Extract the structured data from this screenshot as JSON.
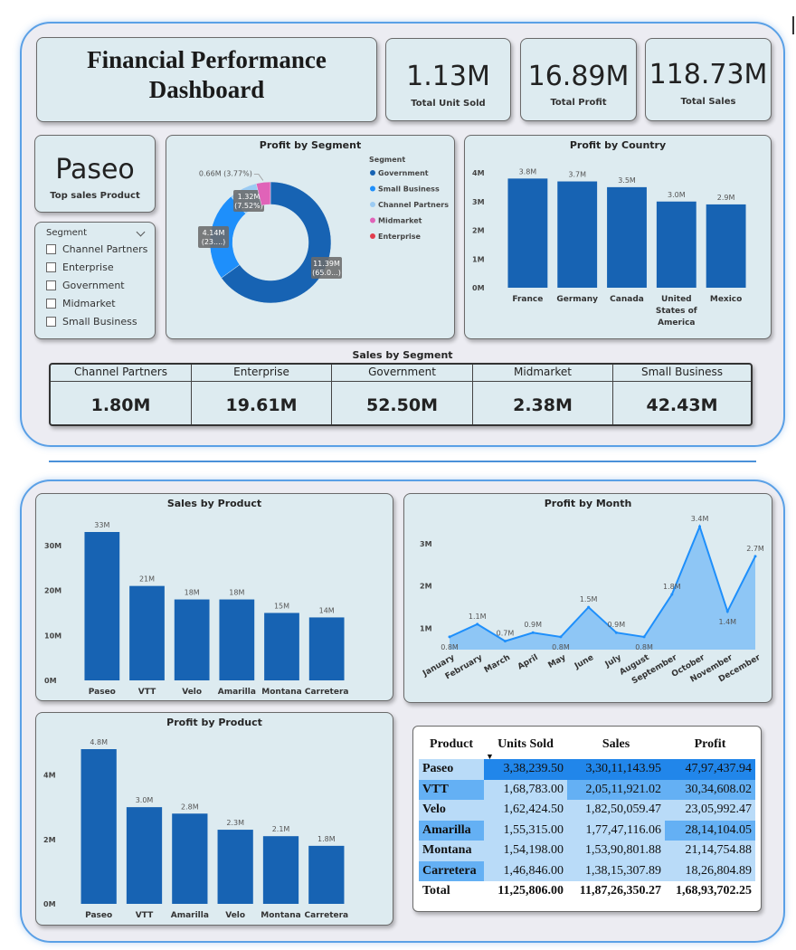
{
  "title": "Financial Performance Dashboard",
  "kpis": [
    {
      "value": "1.13M",
      "label": "Total Unit Sold"
    },
    {
      "value": "16.89M",
      "label": "Total Profit"
    },
    {
      "value": "118.73M",
      "label": "Total Sales"
    }
  ],
  "top_product": {
    "value": "Paseo",
    "label": "Top sales Product"
  },
  "slicer": {
    "title": "Segment",
    "items": [
      "Channel Partners",
      "Enterprise",
      "Government",
      "Midmarket",
      "Small Business"
    ]
  },
  "sales_by_segment": {
    "title": "Sales by Segment",
    "items": [
      {
        "name": "Channel Partners",
        "value": "1.80M"
      },
      {
        "name": "Enterprise",
        "value": "19.61M"
      },
      {
        "name": "Government",
        "value": "52.50M"
      },
      {
        "name": "Midmarket",
        "value": "2.38M"
      },
      {
        "name": "Small Business",
        "value": "42.43M"
      }
    ]
  },
  "colors": {
    "bar": "#1763b3",
    "government": "#1763b3",
    "small_business": "#1e8ffb",
    "channel_partners": "#9bcbf3",
    "midmarket": "#e063b8",
    "enterprise": "#e23d4d",
    "area_fill": "#8ec6f5",
    "area_line": "#1e8ffb",
    "table_highlight": "#2186ea",
    "table_mid": "#64b0f4",
    "table_light": "#b9dbf8"
  },
  "chart_data": [
    {
      "id": "profit_by_segment",
      "type": "pie",
      "title": "Profit by Segment",
      "legend_title": "Segment",
      "legend_position": "right",
      "legend": [
        "Government",
        "Small Business",
        "Channel Partners",
        "Midmarket",
        "Enterprise"
      ],
      "slices": [
        {
          "name": "Government",
          "value": 11.39,
          "label_line1": "11.39M",
          "label_line2": "(65.0...)"
        },
        {
          "name": "Small Business",
          "value": 4.14,
          "label_line1": "4.14M",
          "label_line2": "(23....)"
        },
        {
          "name": "Channel Partners",
          "value": 1.32,
          "label_line1": "1.32M",
          "label_line2": "(7.52%)"
        },
        {
          "name": "Midmarket",
          "value": 0.66,
          "label_line1": "0.66M (3.77%)",
          "label_line2": ""
        },
        {
          "name": "Enterprise",
          "value": 0.0,
          "label_line1": "",
          "label_line2": ""
        }
      ]
    },
    {
      "id": "profit_by_country",
      "type": "bar",
      "title": "Profit by Country",
      "categories": [
        [
          "France"
        ],
        [
          "Germany"
        ],
        [
          "Canada"
        ],
        [
          "United",
          "States of",
          "America"
        ],
        [
          "Mexico"
        ]
      ],
      "values": [
        3.8,
        3.7,
        3.5,
        3.0,
        2.9
      ],
      "data_labels": [
        "3.8M",
        "3.7M",
        "3.5M",
        "3.0M",
        "2.9M"
      ],
      "ylim": [
        0,
        4
      ],
      "yticks": [
        {
          "v": 0,
          "label": "0M"
        },
        {
          "v": 1,
          "label": "1M"
        },
        {
          "v": 2,
          "label": "2M"
        },
        {
          "v": 3,
          "label": "3M"
        },
        {
          "v": 4,
          "label": "4M"
        }
      ]
    },
    {
      "id": "sales_by_product",
      "type": "bar",
      "title": "Sales by Product",
      "categories": [
        [
          "Paseo"
        ],
        [
          "VTT"
        ],
        [
          "Velo"
        ],
        [
          "Amarilla"
        ],
        [
          "Montana"
        ],
        [
          "Carretera"
        ]
      ],
      "values": [
        33,
        21,
        18,
        18,
        15,
        14
      ],
      "data_labels": [
        "33M",
        "21M",
        "18M",
        "18M",
        "15M",
        "14M"
      ],
      "ylim": [
        0,
        33
      ],
      "yticks": [
        {
          "v": 0,
          "label": "0M"
        },
        {
          "v": 10,
          "label": "10M"
        },
        {
          "v": 20,
          "label": "20M"
        },
        {
          "v": 30,
          "label": "30M"
        }
      ]
    },
    {
      "id": "profit_by_month",
      "type": "area",
      "title": "Profit by Month",
      "categories": [
        "January",
        "February",
        "March",
        "April",
        "May",
        "June",
        "July",
        "August",
        "September",
        "October",
        "November",
        "December"
      ],
      "values": [
        0.8,
        1.1,
        0.7,
        0.9,
        0.8,
        1.5,
        0.9,
        0.8,
        1.8,
        3.4,
        1.4,
        2.7
      ],
      "data_labels": [
        "0.8M",
        "1.1M",
        "0.7M",
        "0.9M",
        "0.8M",
        "1.5M",
        "0.9M",
        "0.8M",
        "1.8M",
        "3.4M",
        "1.4M",
        "2.7M"
      ],
      "label_below": [
        true,
        false,
        false,
        false,
        true,
        false,
        false,
        true,
        false,
        false,
        true,
        false
      ],
      "ylim": [
        0.5,
        3.4
      ],
      "yticks": [
        {
          "v": 1,
          "label": "1M"
        },
        {
          "v": 2,
          "label": "2M"
        },
        {
          "v": 3,
          "label": "3M"
        }
      ]
    },
    {
      "id": "profit_by_product",
      "type": "bar",
      "title": "Profit by Product",
      "categories": [
        [
          "Paseo"
        ],
        [
          "VTT"
        ],
        [
          "Amarilla"
        ],
        [
          "Velo"
        ],
        [
          "Montana"
        ],
        [
          "Carretera"
        ]
      ],
      "values": [
        4.8,
        3.0,
        2.8,
        2.3,
        2.1,
        1.8
      ],
      "data_labels": [
        "4.8M",
        "3.0M",
        "2.8M",
        "2.3M",
        "2.1M",
        "1.8M"
      ],
      "ylim": [
        0,
        4.8
      ],
      "yticks": [
        {
          "v": 0,
          "label": "0M"
        },
        {
          "v": 2,
          "label": "2M"
        },
        {
          "v": 4,
          "label": "4M"
        }
      ]
    },
    {
      "id": "product_table",
      "type": "table",
      "columns": [
        "Product",
        "Units Sold",
        "Sales",
        "Profit"
      ],
      "rows": [
        [
          "Paseo",
          "3,38,239.50",
          "3,30,11,143.95",
          "47,97,437.94"
        ],
        [
          "VTT",
          "1,68,783.00",
          "2,05,11,921.02",
          "30,34,608.02"
        ],
        [
          "Velo",
          "1,62,424.50",
          "1,82,50,059.47",
          "23,05,992.47"
        ],
        [
          "Amarilla",
          "1,55,315.00",
          "1,77,47,116.06",
          "28,14,104.05"
        ],
        [
          "Montana",
          "1,54,198.00",
          "1,53,90,801.88",
          "21,14,754.88"
        ],
        [
          "Carretera",
          "1,46,846.00",
          "1,38,15,307.89",
          "18,26,804.89"
        ]
      ],
      "total": [
        "Total",
        "11,25,806.00",
        "11,87,26,350.27",
        "1,68,93,702.25"
      ]
    }
  ]
}
